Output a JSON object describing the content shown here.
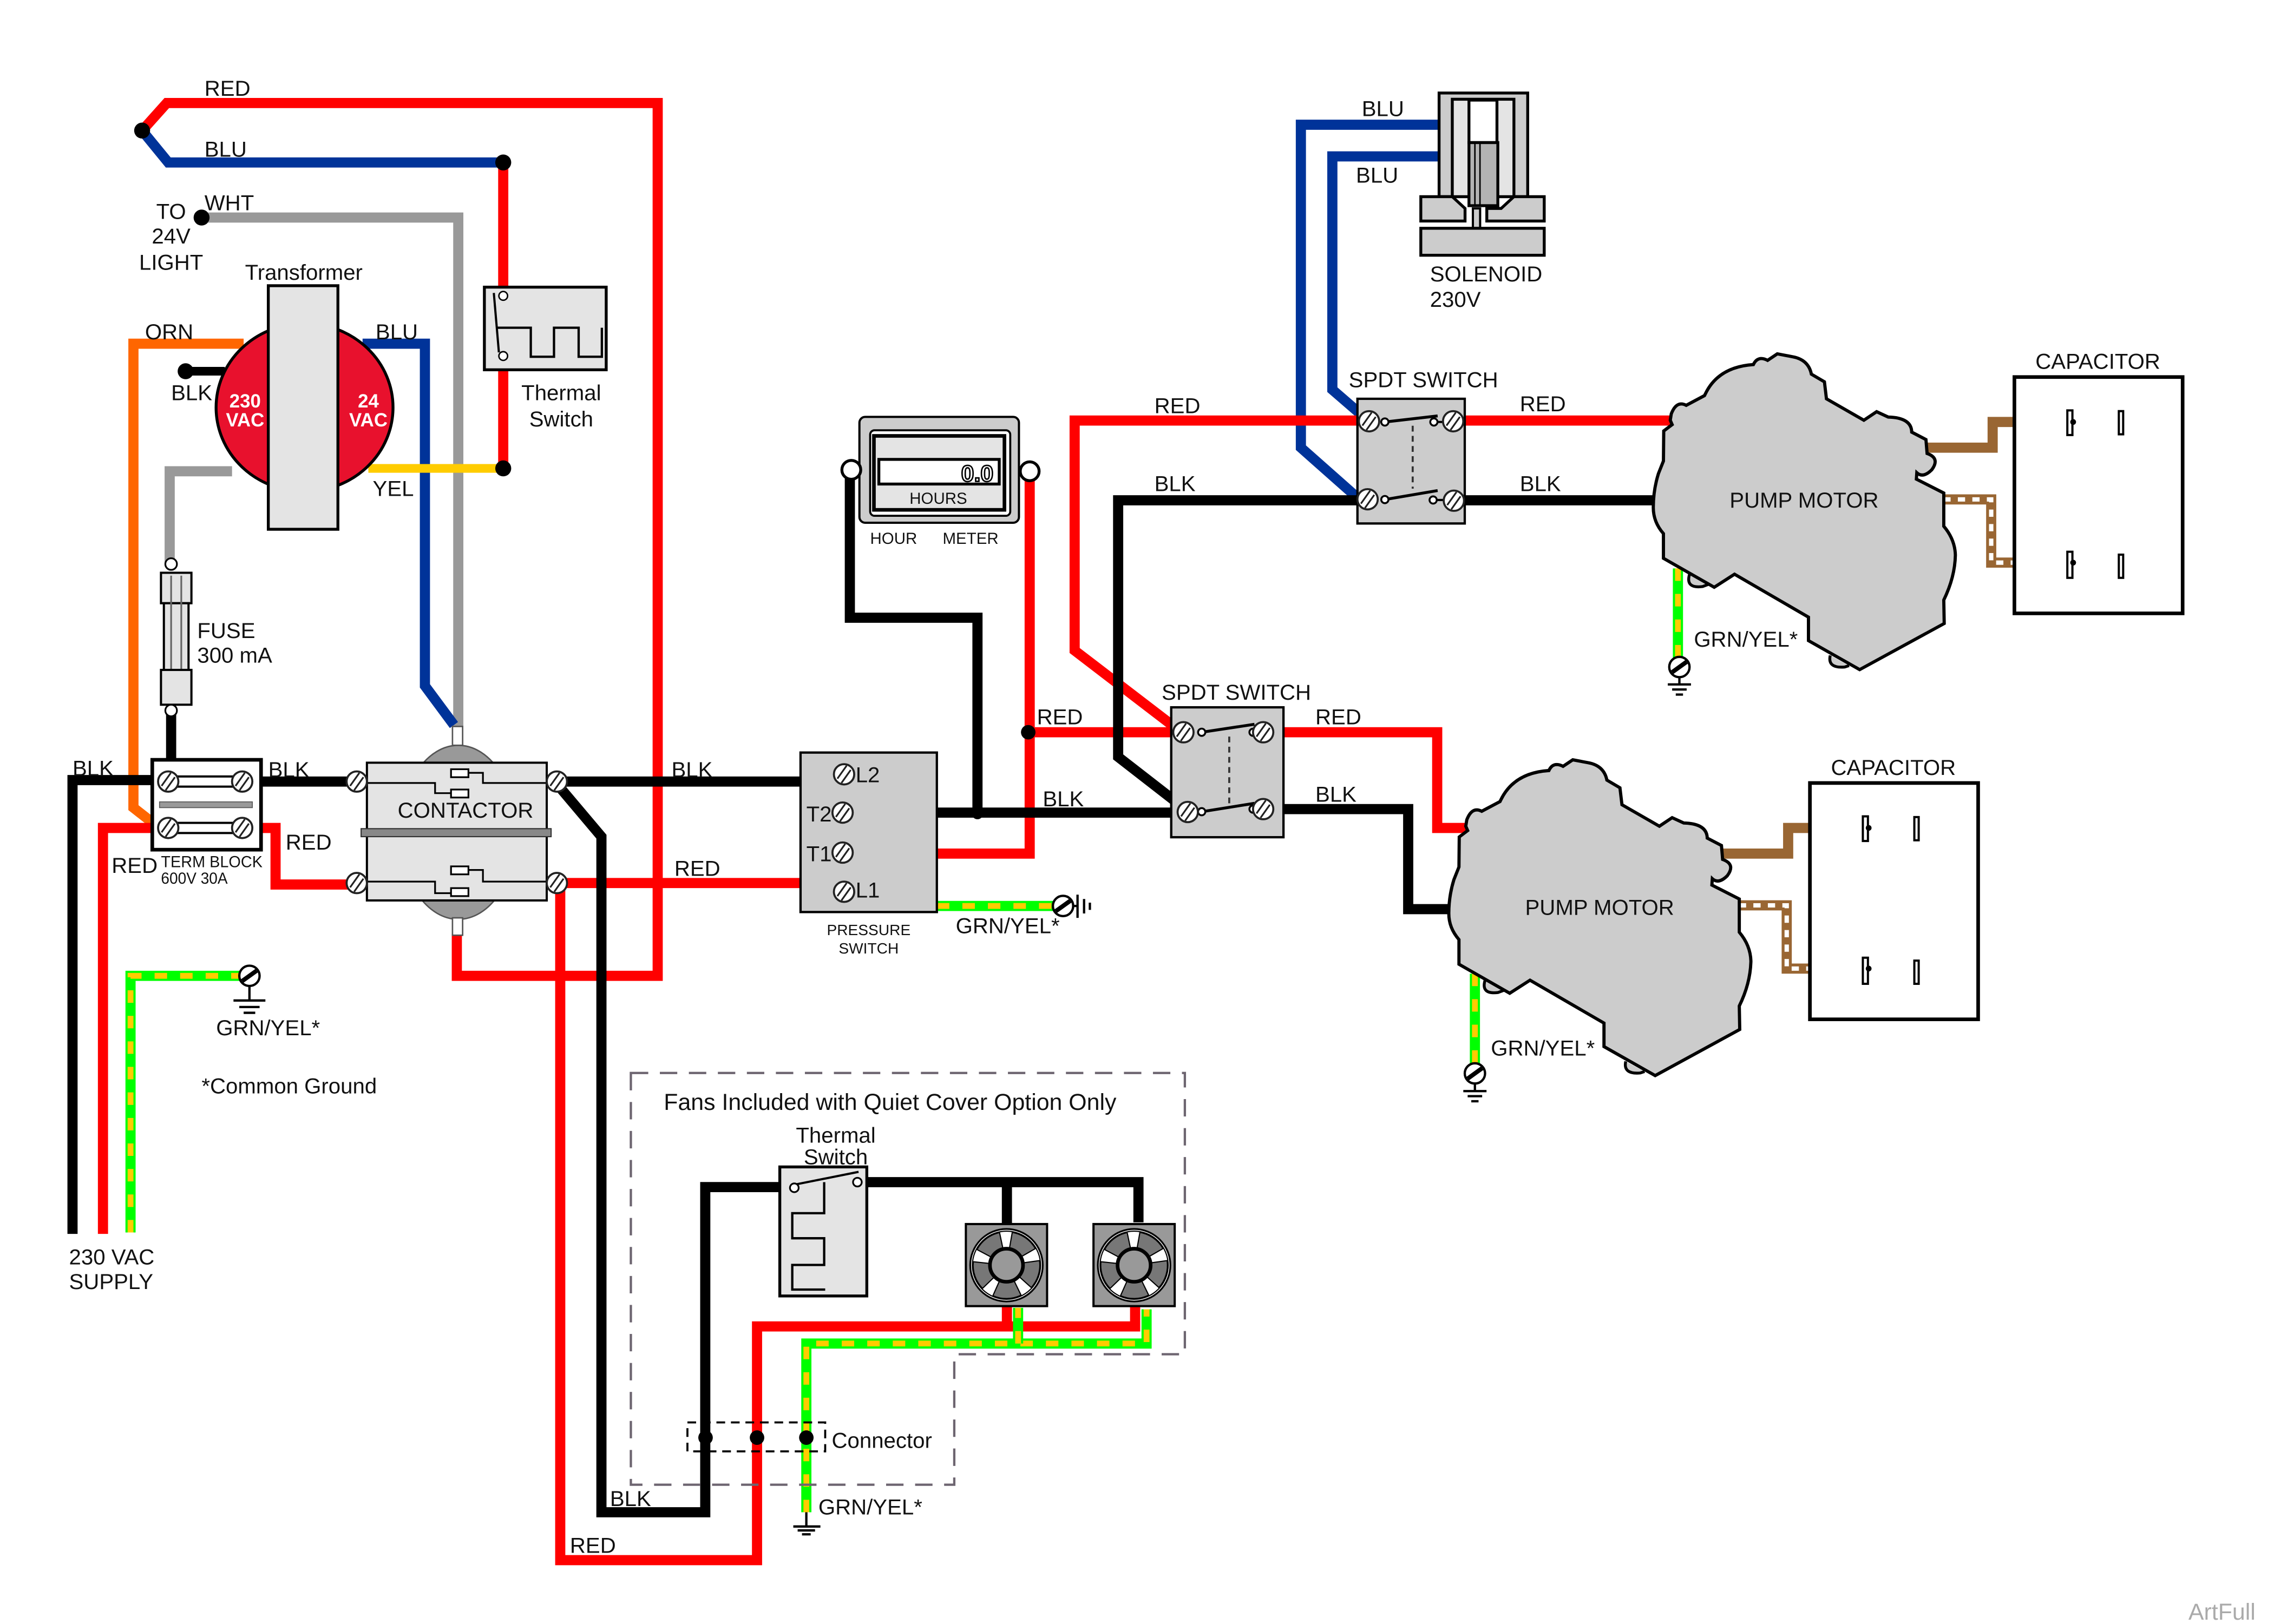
{
  "wire_colors": {
    "red": "#ff0000",
    "black": "#000000",
    "blue": "#003399",
    "gray": "#999999",
    "orange": "#ff6600",
    "yellow": "#ffcc00",
    "ground_green": "#00ff00",
    "ground_stripe": "#ffcc00",
    "brown": "#996633"
  },
  "component_colors": {
    "transformer_coil": "#e8112d",
    "body": "#cccccc",
    "body_light": "#e4e4e4"
  },
  "wire_labels": {
    "top_red": "RED",
    "top_blu": "BLU",
    "wht": "WHT",
    "orn": "ORN",
    "xfmr_blk": "BLK",
    "xfmr_blu": "BLU",
    "yel": "YEL",
    "supply_blk": "BLK",
    "tb_blk": "BLK",
    "supply_red": "RED",
    "tb_red": "RED",
    "l2_blk": "BLK",
    "l1_red": "RED",
    "meter_red": "RED",
    "t2_blk": "BLK",
    "spdt_upper_red_in": "RED",
    "spdt_upper_blk_in": "BLK",
    "spdt_upper_red_out": "RED",
    "spdt_upper_blk_out": "BLK",
    "spdt_lower_red_out": "RED",
    "spdt_lower_blk_out": "BLK",
    "solenoid_blu_1": "BLU",
    "solenoid_blu_2": "BLU",
    "fan_blk": "BLK",
    "fan_red": "RED",
    "ground_main": "GRN/YEL*",
    "ground_pressure": "GRN/YEL*",
    "ground_motor_1": "GRN/YEL*",
    "ground_motor_2": "GRN/YEL*",
    "ground_fan": "GRN/YEL*"
  },
  "components": {
    "light_label": [
      "TO",
      "24V",
      "LIGHT"
    ],
    "transformer": {
      "label": "Transformer",
      "primary_voltage": "230",
      "primary_unit": "VAC",
      "secondary_voltage": "24",
      "secondary_unit": "VAC"
    },
    "thermal_switch_main": {
      "label_line1": "Thermal",
      "label_line2": "Switch"
    },
    "fuse": {
      "label": "FUSE",
      "rating": "300 mA"
    },
    "term_block": {
      "label": "TERM BLOCK",
      "rating": "600V 30A"
    },
    "contactor": {
      "label": "CONTACTOR"
    },
    "hour_meter": {
      "reading": "0.0",
      "unit": "HOURS",
      "label_line1": "HOUR",
      "label_line2": "METER"
    },
    "pressure_switch": {
      "label_line1": "PRESSURE",
      "label_line2": "SWITCH",
      "terminals": {
        "l2": "L2",
        "t2": "T2",
        "t1": "T1",
        "l1": "L1"
      }
    },
    "spdt_switch_upper": {
      "label": "SPDT SWITCH"
    },
    "spdt_switch_lower": {
      "label": "SPDT SWITCH"
    },
    "solenoid": {
      "label": "SOLENOID",
      "rating": "230V"
    },
    "pump_motor_1": {
      "label": "PUMP MOTOR"
    },
    "pump_motor_2": {
      "label": "PUMP MOTOR"
    },
    "capacitor_1": {
      "label": "CAPACITOR"
    },
    "capacitor_2": {
      "label": "CAPACITOR"
    },
    "fan_option": {
      "title": "Fans Included with Quiet Cover Option Only",
      "thermal_switch_line1": "Thermal",
      "thermal_switch_line2": "Switch",
      "connector": "Connector"
    },
    "supply": {
      "line1": "230 VAC",
      "line2": "SUPPLY"
    }
  },
  "notes": {
    "common_ground": "*Common Ground"
  },
  "watermark": "ArtFull"
}
